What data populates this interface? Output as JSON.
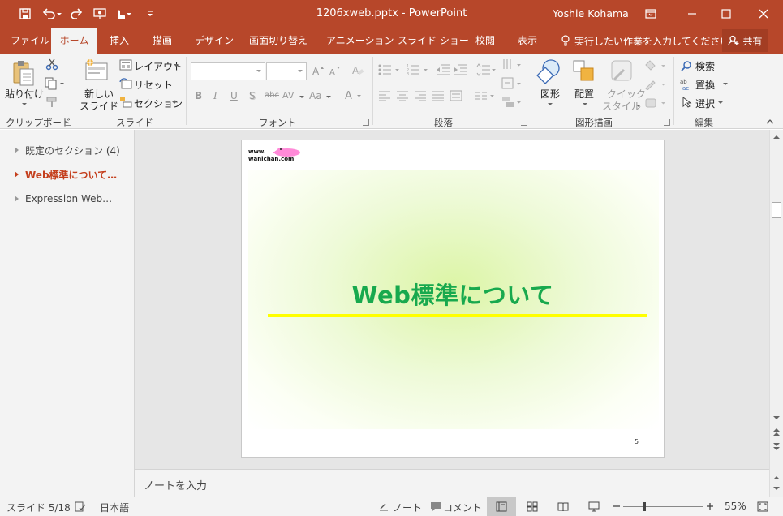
{
  "titlebar": {
    "doc_title": "1206xweb.pptx - PowerPoint",
    "user": "Yoshie Kohama",
    "icons": [
      "save-icon",
      "undo-icon",
      "redo-icon",
      "present-from-start-icon",
      "touch-mode-icon",
      "customize-qat-icon",
      "ribbon-display-options-icon",
      "minimize-icon",
      "maximize-icon",
      "close-icon"
    ],
    "accent": "#b7472a"
  },
  "tabs": [
    {
      "label": "ファイル"
    },
    {
      "label": "ホーム"
    },
    {
      "label": "挿入"
    },
    {
      "label": "描画"
    },
    {
      "label": "デザイン"
    },
    {
      "label": "画面切り替え"
    },
    {
      "label": "アニメーション"
    },
    {
      "label": "スライド ショー"
    },
    {
      "label": "校閲"
    },
    {
      "label": "表示"
    }
  ],
  "tell_me": "実行したい作業を入力してください",
  "share": "共有",
  "ribbon": {
    "clipboard": {
      "group": "クリップボード",
      "paste": "貼り付け"
    },
    "slides": {
      "group": "スライド",
      "new_slide_1": "新しい",
      "new_slide_2": "スライド",
      "layout": "レイアウト",
      "reset": "リセット",
      "section": "セクション"
    },
    "font": {
      "group": "フォント",
      "name_value": "",
      "size_value": "",
      "bold": "B",
      "italic": "I",
      "underline": "U",
      "shadow": "S",
      "strike": "abc",
      "spacing": "AV",
      "case": "Aa"
    },
    "paragraph": {
      "group": "段落"
    },
    "drawing": {
      "group": "図形描画",
      "shapes": "図形",
      "arrange": "配置",
      "quick_1": "クイック",
      "quick_2": "スタイル"
    },
    "editing": {
      "group": "編集",
      "find": "検索",
      "replace": "置換",
      "select": "選択"
    }
  },
  "sections": [
    {
      "label": "既定のセクション (4)"
    },
    {
      "label": "Web標準について…"
    },
    {
      "label": "Expression Web…"
    }
  ],
  "slide": {
    "logo_line1": "www.",
    "logo_line2": "wanichan.com",
    "title": "Web標準について",
    "number": "5",
    "title_color": "#18a94e",
    "line_color": "#ffff00"
  },
  "notes_placeholder": "ノートを入力",
  "status": {
    "slide_count": "スライド 5/18",
    "language": "日本語",
    "notes": "ノート",
    "comments": "コメント",
    "zoom": "55%",
    "zoom_level": 0.55
  }
}
